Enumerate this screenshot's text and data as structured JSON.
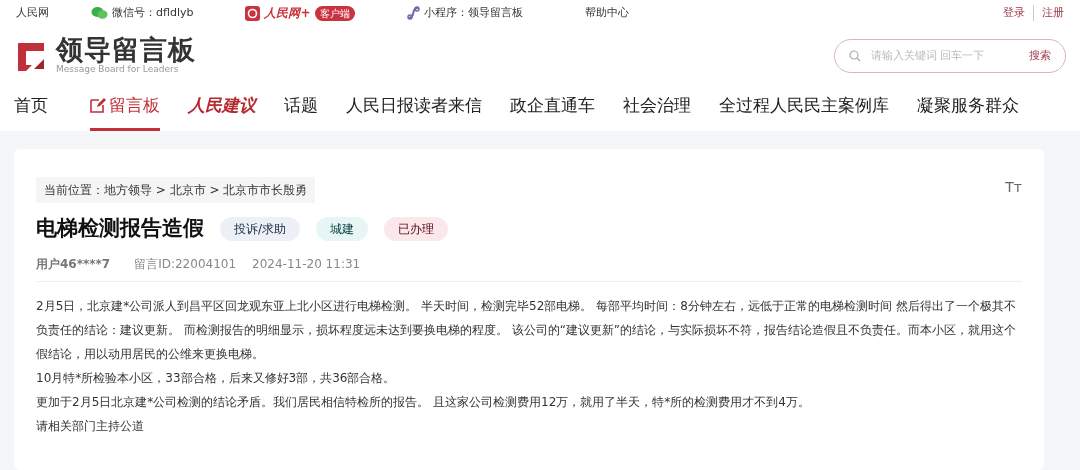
{
  "top_bar": {
    "left": [
      {
        "kind": "text",
        "label": "人民网"
      },
      {
        "kind": "wechat",
        "label": "微信号：dfldlyb"
      },
      {
        "kind": "app",
        "label": "人民网+",
        "badge": "客户端"
      },
      {
        "kind": "mini",
        "label": "小程序：领导留言板"
      },
      {
        "kind": "text",
        "label": "帮助中心"
      }
    ],
    "right": [
      "登录",
      "注册"
    ]
  },
  "logo": {
    "title": "领导留言板",
    "subtitle": "Message Board for Leaders"
  },
  "search": {
    "placeholder": "请输入关键词 回车一下",
    "button": "搜索"
  },
  "nav": [
    {
      "label": "首页",
      "kind": "text",
      "selected": false
    },
    {
      "label": "留言板",
      "kind": "icon",
      "selected": true
    },
    {
      "label": "人民建议",
      "kind": "script",
      "selected": false
    },
    {
      "label": "话题",
      "kind": "text",
      "selected": false
    },
    {
      "label": "人民日报读者来信",
      "kind": "text",
      "selected": false
    },
    {
      "label": "政企直通车",
      "kind": "text",
      "selected": false
    },
    {
      "label": "社会治理",
      "kind": "text",
      "selected": false
    },
    {
      "label": "全过程人民民主案例库",
      "kind": "text",
      "selected": false
    },
    {
      "label": "凝聚服务群众",
      "kind": "text",
      "selected": false
    }
  ],
  "breadcrumb": "当前位置：地方领导 > 北京市 > 北京市市长殷勇",
  "font_size_toggle": "Tт",
  "post": {
    "title": "电梯检测报告造假",
    "tags": [
      {
        "label": "投诉/求助",
        "color": "#edf1f7"
      },
      {
        "label": "城建",
        "color": "#e7f5f5"
      },
      {
        "label": "已办理",
        "color": "#fbe8eb"
      }
    ],
    "user": "用户46****7",
    "message_id": "留言ID:22004101",
    "time": "2024-11-20 11:31",
    "paragraphs": [
      "2月5日，北京建*公司派人到昌平区回龙观东亚上北小区进行电梯检测。 半天时间，检测完毕52部电梯。 每部平均时间：8分钟左右，远低于正常的电梯检测时间 然后得出了一个极其不负责任的结论：建议更新。 而检测报告的明细显示，损坏程度远未达到要换电梯的程度。 该公司的“建议更新”的结论，与实际损坏不符，报告结论造假且不负责任。而本小区，就用这个假结论，用以动用居民的公维来更换电梯。",
      "10月特*所检验本小区，33部合格，后来又修好3部，共36部合格。",
      "更加于2月5日北京建*公司检测的结论矛盾。我们居民相信特检所的报告。 且这家公司检测费用12万，就用了半天，特*所的检测费用才不到4万。",
      "请相关部门主持公道"
    ]
  }
}
